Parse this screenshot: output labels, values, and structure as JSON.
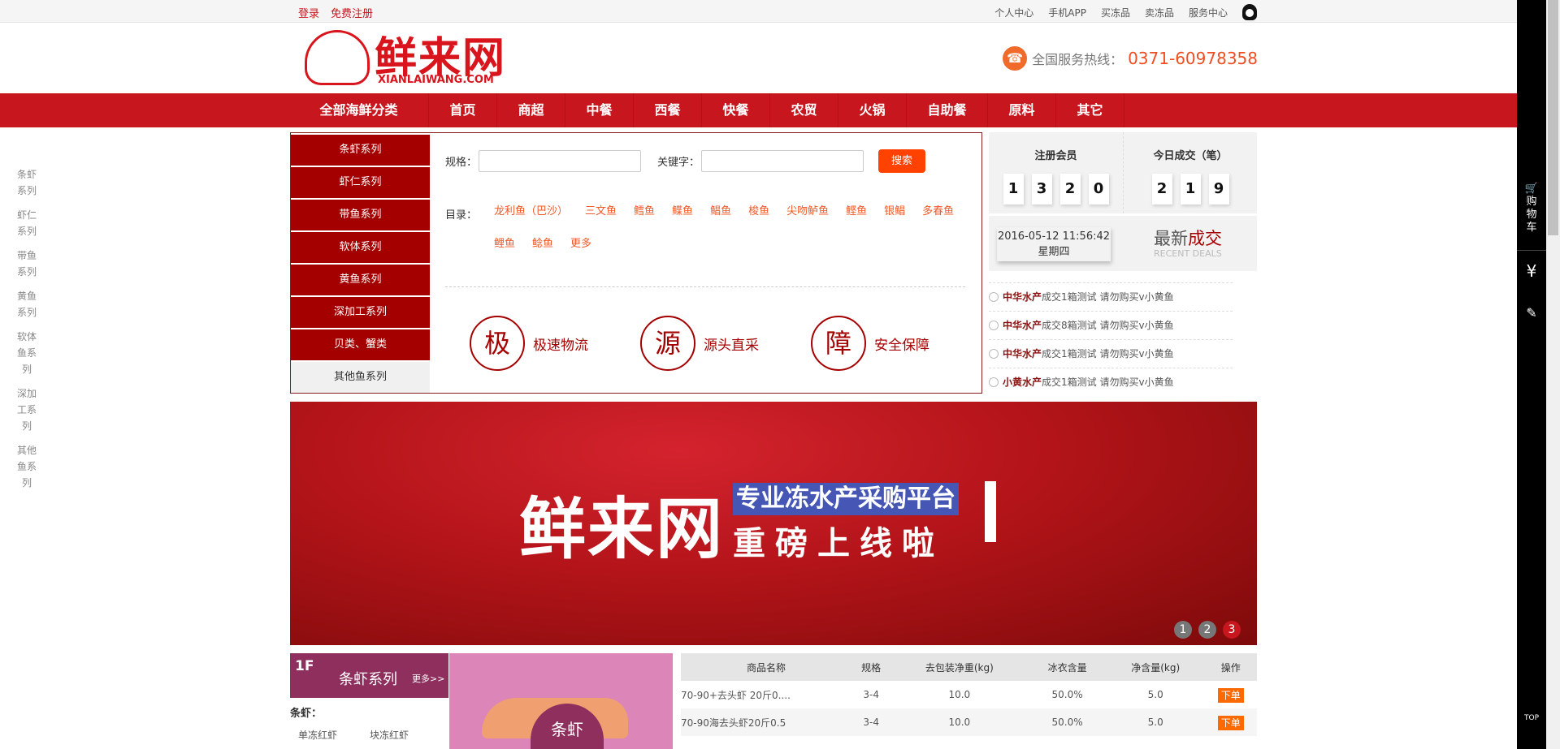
{
  "topbar": {
    "login": "登录",
    "register": "免费注册",
    "links": [
      "个人中心",
      "手机APP",
      "买冻品",
      "卖冻品",
      "服务中心"
    ]
  },
  "header": {
    "logo_cn": "鲜来网",
    "logo_en": "XIANLAIWANG.COM",
    "hotline_label": "全国服务热线：",
    "hotline": "0371-60978358"
  },
  "nav": {
    "all": "全部海鲜分类",
    "items": [
      "首页",
      "商超",
      "中餐",
      "西餐",
      "快餐",
      "农贸",
      "火锅",
      "自助餐",
      "原料",
      "其它"
    ]
  },
  "categories": [
    "条虾系列",
    "虾仁系列",
    "带鱼系列",
    "软体系列",
    "黄鱼系列",
    "深加工系列",
    "贝类、蟹类",
    "其他鱼系列"
  ],
  "search": {
    "spec_label": "规格：",
    "keyword_label": "关键字：",
    "button": "搜索"
  },
  "directory": {
    "label": "目录：",
    "links": [
      "龙利鱼（巴沙）",
      "三文鱼",
      "鳕鱼",
      "鲽鱼",
      "鲳鱼",
      "梭鱼",
      "尖吻鲈鱼",
      "鲣鱼",
      "银鲳",
      "多春鱼",
      "鲤鱼",
      "鲶鱼",
      "更多"
    ]
  },
  "features": [
    {
      "icon": "极",
      "label": "极速物流"
    },
    {
      "icon": "源",
      "label": "源头直采"
    },
    {
      "icon": "障",
      "label": "安全保障"
    }
  ],
  "stats": {
    "members_label": "注册会员",
    "members": [
      "1",
      "3",
      "2",
      "0"
    ],
    "today_label": "今日成交（笔）",
    "today": [
      "2",
      "1",
      "9"
    ]
  },
  "clock": {
    "datetime": "2016-05-12 11:56:42",
    "weekday": "星期四"
  },
  "recent": {
    "title_a": "最新",
    "title_b": "成交",
    "en": "RECENT DEALS",
    "deals": [
      {
        "company": "中华水产",
        "text": "成交1箱测试 请勿购买v小黄鱼"
      },
      {
        "company": "中华水产",
        "text": "成交8箱测试 请勿购买v小黄鱼"
      },
      {
        "company": "中华水产",
        "text": "成交1箱测试 请勿购买v小黄鱼"
      },
      {
        "company": "小黄水产",
        "text": "成交1箱测试 请勿购买v小黄鱼"
      }
    ]
  },
  "banner": {
    "brand": "鲜来网",
    "tagline": "专业冻水产采购平台",
    "subline": "重磅上线啦",
    "pages": [
      "1",
      "2",
      "3"
    ],
    "active_page": 3
  },
  "floor": {
    "num": "1F",
    "title": "条虾系列",
    "more": "更多>>",
    "sub_label": "条虾：",
    "subs": [
      "单冻红虾",
      "块冻红虾"
    ],
    "image_text": "条虾"
  },
  "table": {
    "headers": [
      "商品名称",
      "规格",
      "去包装净重(kg)",
      "冰衣含量",
      "净含量(kg)",
      "操作"
    ],
    "rows": [
      [
        "70-90+去头虾 20斤0....",
        "3-4",
        "10.0",
        "50.0%",
        "5.0",
        "下单"
      ],
      [
        "70-90海去头虾20斤0.5",
        "3-4",
        "10.0",
        "50.0%",
        "5.0",
        "下单"
      ]
    ]
  },
  "left_sidebar": [
    "条虾系列",
    "虾仁系列",
    "带鱼系列",
    "黄鱼系列",
    "软体鱼系列",
    "深加工系列",
    "其他鱼系列"
  ],
  "toolbar": {
    "cart": "购物车",
    "yen": "¥",
    "top": "TOP"
  }
}
